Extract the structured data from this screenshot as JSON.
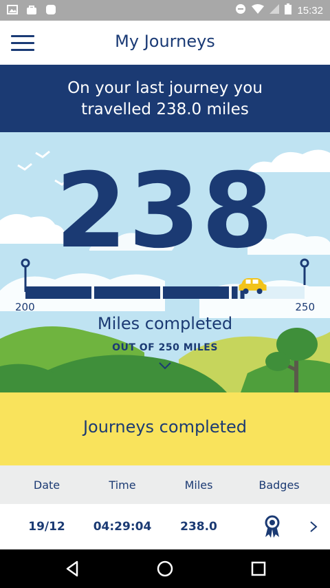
{
  "status_bar": {
    "time": "15:32",
    "left_icons": [
      "image-icon",
      "shopping-bag-icon",
      "app-icon"
    ],
    "right_icons": [
      "do-not-disturb-icon",
      "wifi-icon",
      "signal-icon",
      "battery-icon"
    ]
  },
  "app_bar": {
    "title": "My Journeys",
    "menu_icon": "hamburger-menu-icon"
  },
  "banner": {
    "line1": "On your last journey you",
    "line2": "travelled 238.0 miles"
  },
  "progress": {
    "miles": "238",
    "scale_start": "200",
    "scale_end": "250",
    "fraction": 0.76,
    "label": "Miles completed",
    "sublabel": "OUT OF 250 MILES"
  },
  "journeys": {
    "heading": "Journeys completed",
    "columns": [
      "Date",
      "Time",
      "Miles",
      "Badges"
    ],
    "rows": [
      {
        "date": "19/12",
        "time": "04:29:04",
        "miles": "238.0",
        "badge_icon": "ribbon-badge-icon"
      }
    ]
  },
  "colors": {
    "navy": "#1b3a73",
    "sky": "#bfe3f2",
    "yellow": "#f9e35c",
    "grass": "#6fb43f"
  }
}
